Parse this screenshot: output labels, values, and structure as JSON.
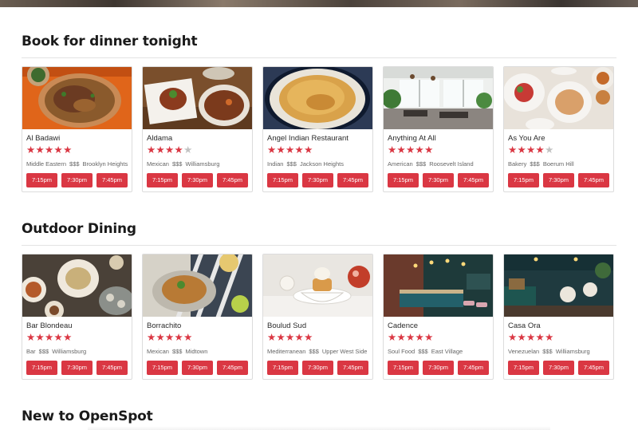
{
  "sections": [
    {
      "title": "Book for dinner tonight",
      "cards": [
        {
          "name": "Al Badawi",
          "rating": 5,
          "cuisine": "Middle Eastern",
          "price": "$$$",
          "neighborhood": "Brooklyn Heights",
          "times": [
            "7:15pm",
            "7:30pm",
            "7:45pm"
          ]
        },
        {
          "name": "Aldama",
          "rating": 4,
          "cuisine": "Mexican",
          "price": "$$$",
          "neighborhood": "Williamsburg",
          "times": [
            "7:15pm",
            "7:30pm",
            "7:45pm"
          ]
        },
        {
          "name": "Angel Indian Restaurant",
          "rating": 5,
          "cuisine": "Indian",
          "price": "$$$",
          "neighborhood": "Jackson Heights",
          "times": [
            "7:15pm",
            "7:30pm",
            "7:45pm"
          ]
        },
        {
          "name": "Anything At All",
          "rating": 5,
          "cuisine": "American",
          "price": "$$$",
          "neighborhood": "Roosevelt Island",
          "times": [
            "7:15pm",
            "7:30pm",
            "7:45pm"
          ]
        },
        {
          "name": "As You Are",
          "rating": 4,
          "cuisine": "Bakery",
          "price": "$$$",
          "neighborhood": "Boerum Hill",
          "times": [
            "7:15pm",
            "7:30pm",
            "7:45pm"
          ]
        }
      ]
    },
    {
      "title": "Outdoor Dining",
      "cards": [
        {
          "name": "Bar Blondeau",
          "rating": 5,
          "cuisine": "Bar",
          "price": "$$$",
          "neighborhood": "Williamsburg",
          "times": [
            "7:15pm",
            "7:30pm",
            "7:45pm"
          ]
        },
        {
          "name": "Borrachito",
          "rating": 5,
          "cuisine": "Mexican",
          "price": "$$$",
          "neighborhood": "Midtown",
          "times": [
            "7:15pm",
            "7:30pm",
            "7:45pm"
          ]
        },
        {
          "name": "Boulud Sud",
          "rating": 5,
          "cuisine": "Mediterranean",
          "price": "$$$",
          "neighborhood": "Upper West Side",
          "times": [
            "7:15pm",
            "7:30pm",
            "7:45pm"
          ]
        },
        {
          "name": "Cadence",
          "rating": 5,
          "cuisine": "Soul Food",
          "price": "$$$",
          "neighborhood": "East Village",
          "times": [
            "7:15pm",
            "7:30pm",
            "7:45pm"
          ]
        },
        {
          "name": "Casa Ora",
          "rating": 5,
          "cuisine": "Venezuelan",
          "price": "$$$",
          "neighborhood": "Williamsburg",
          "times": [
            "7:15pm",
            "7:30pm",
            "7:45pm"
          ]
        }
      ]
    },
    {
      "title": "New to OpenSpot",
      "cards": []
    }
  ],
  "theme": {
    "accent": "#da3743",
    "star_off": "#c2c2c2"
  }
}
